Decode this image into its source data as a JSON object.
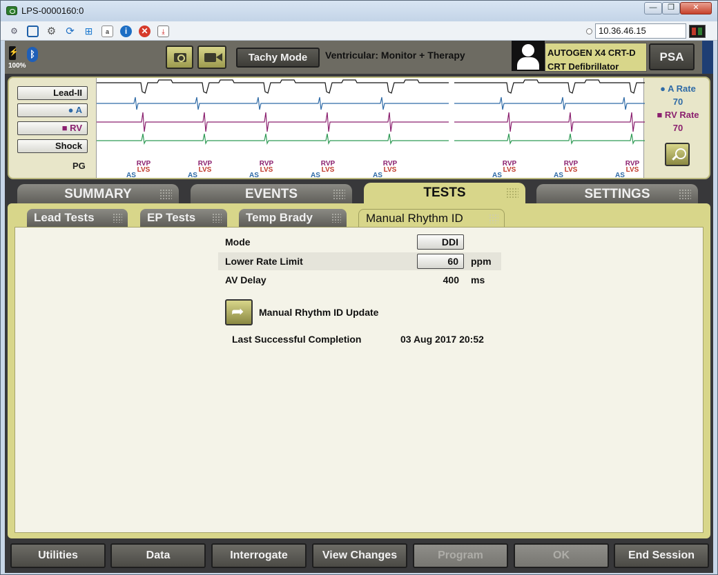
{
  "window": {
    "title": "LPS-0000160:0",
    "min": "—",
    "max": "❐",
    "close": "✕"
  },
  "toolbar": {
    "ip_address": "10.36.46.15"
  },
  "header": {
    "battery_pct": "100%",
    "bluetooth": "ᛒ",
    "tachy_mode_label": "Tachy Mode",
    "ventricular_mode": "Ventricular: Monitor + Therapy",
    "device_line1": "AUTOGEN X4 CRT-D",
    "device_line2": "CRT Defibrillator",
    "psa_label": "PSA"
  },
  "ecg": {
    "leads": [
      "Lead-II",
      "● A",
      "■ RV",
      "Shock"
    ],
    "pg_label": "PG",
    "markers": {
      "rvp": "RVP",
      "lvs": "LVS",
      "as": "AS"
    },
    "a_rate_label": "● A Rate",
    "a_rate_value": "70",
    "rv_rate_label": "■ RV Rate",
    "rv_rate_value": "70",
    "colors": {
      "a": "#2e6aa6",
      "rv": "#8a1f6e",
      "shock": "#2f9a55",
      "lead": "#111111"
    }
  },
  "main_tabs": [
    "SUMMARY",
    "EVENTS",
    "TESTS",
    "SETTINGS"
  ],
  "active_main_tab": "TESTS",
  "sub_tabs": [
    "Lead Tests",
    "EP Tests",
    "Temp Brady",
    "Manual Rhythm ID"
  ],
  "active_sub_tab": "Manual Rhythm ID",
  "params": [
    {
      "label": "Mode",
      "value": "DDI",
      "unit": ""
    },
    {
      "label": "Lower Rate Limit",
      "value": "60",
      "unit": "ppm"
    },
    {
      "label": "AV Delay",
      "value": "400",
      "unit": "ms"
    }
  ],
  "update_label": "Manual Rhythm ID Update",
  "last_completion_label": "Last Successful Completion",
  "last_completion_value": "03 Aug 2017 20:52",
  "bottom_buttons": [
    "Utilities",
    "Data",
    "Interrogate",
    "View Changes",
    "Program",
    "OK",
    "End Session"
  ]
}
